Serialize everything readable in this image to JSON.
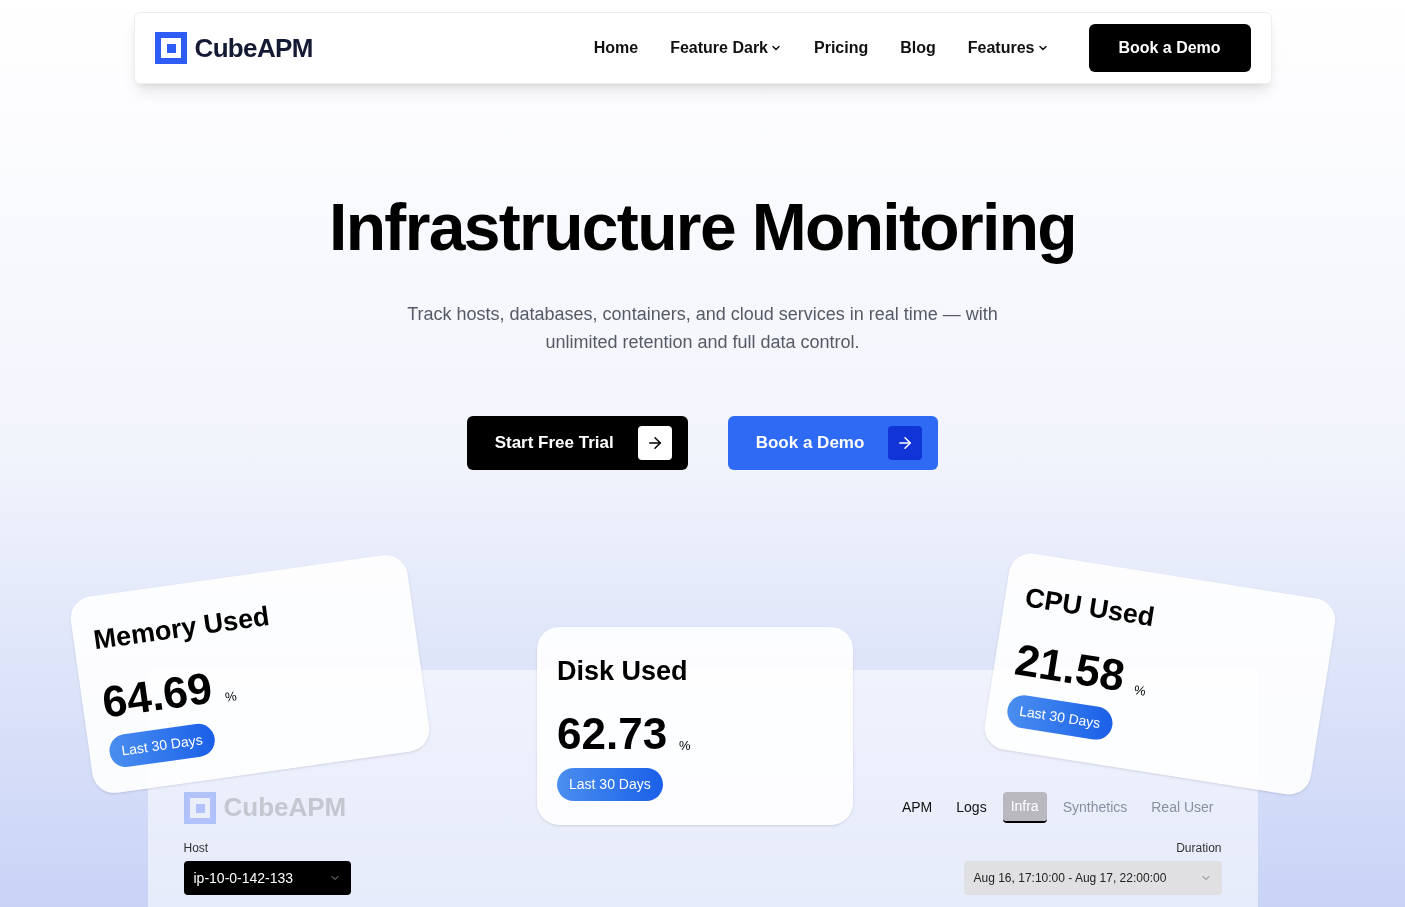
{
  "brand": "CubeAPM",
  "nav": [
    {
      "label": "Home",
      "dropdown": false
    },
    {
      "label": "Feature Dark",
      "dropdown": true
    },
    {
      "label": "Pricing",
      "dropdown": false
    },
    {
      "label": "Blog",
      "dropdown": false
    },
    {
      "label": "Features",
      "dropdown": true
    }
  ],
  "nav_cta": "Book a Demo",
  "hero": {
    "title": "Infrastructure Monitoring",
    "subtitle": "Track hosts, databases, containers, and cloud services in real time — with unlimited retention and full data control."
  },
  "ctas": [
    {
      "label": "Start Free Trial",
      "kind": "dark"
    },
    {
      "label": "Book a Demo",
      "kind": "blue"
    }
  ],
  "cards": [
    {
      "title": "Memory Used",
      "value": "64.69",
      "unit": "%",
      "badge": "Last 30 Days"
    },
    {
      "title": "Disk Used",
      "value": "62.73",
      "unit": "%",
      "badge": "Last 30 Days"
    },
    {
      "title": "CPU Used",
      "value": "21.58",
      "unit": "%",
      "badge": "Last 30 Days"
    }
  ],
  "dashboard": {
    "brand": "CubeAPM",
    "tabs": [
      {
        "label": "APM",
        "selected": false,
        "disabled": false
      },
      {
        "label": "Logs",
        "selected": false,
        "disabled": false
      },
      {
        "label": "Infra",
        "selected": true,
        "disabled": false
      },
      {
        "label": "Synthetics",
        "selected": false,
        "disabled": true
      },
      {
        "label": "Real User",
        "selected": false,
        "disabled": true
      }
    ],
    "host": {
      "label": "Host",
      "value": "ip-10-0-142-133"
    },
    "duration": {
      "label": "Duration",
      "value": "Aug 16, 17:10:00 - Aug 17, 22:00:00"
    }
  }
}
